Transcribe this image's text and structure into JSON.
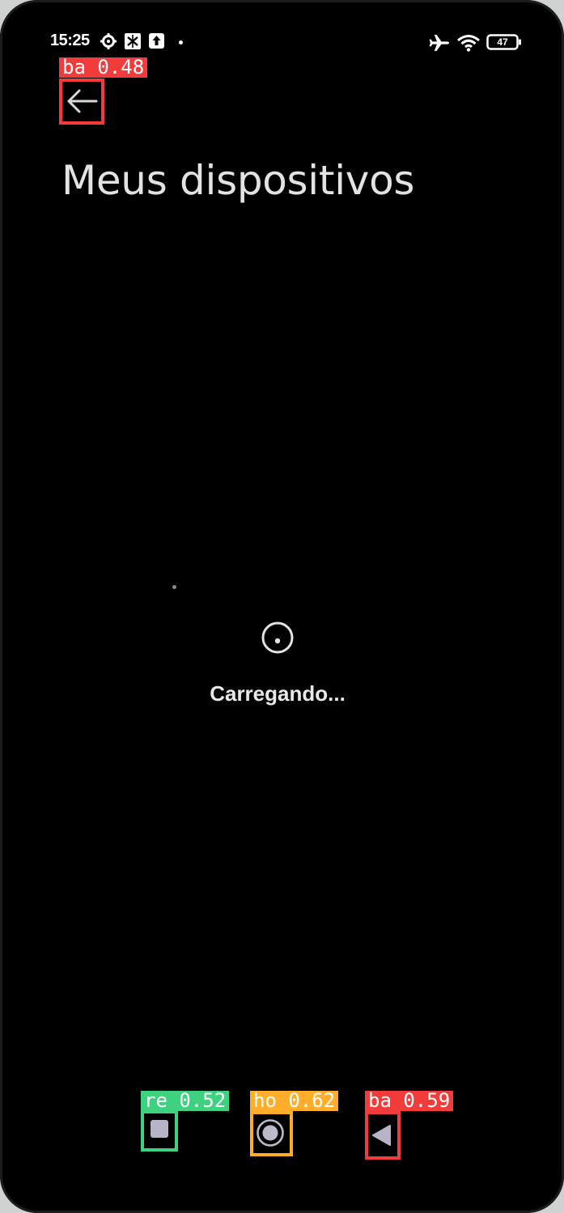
{
  "status_bar": {
    "time": "15:25",
    "left_icons": [
      "settings-gear-icon",
      "sync-icon",
      "upload-notification-icon",
      "dot-icon"
    ],
    "right_icons": [
      "airplane-mode-icon",
      "wifi-icon",
      "battery-icon"
    ],
    "battery_level": "47"
  },
  "header": {
    "back_icon": "arrow-left-icon",
    "title": "Meus dispositivos"
  },
  "content": {
    "spinner_icon": "loading-spinner-icon",
    "loading_text": "Carregando..."
  },
  "nav_bar": {
    "buttons": [
      "recents-square-icon",
      "home-circle-icon",
      "back-triangle-icon"
    ]
  },
  "detections": [
    {
      "label": "ba 0.48",
      "color": "#f23b3b"
    },
    {
      "label": "re 0.52",
      "color": "#3ed17f"
    },
    {
      "label": "ho 0.62",
      "color": "#ffad2a"
    },
    {
      "label": "ba 0.59",
      "color": "#f23b3b"
    }
  ]
}
